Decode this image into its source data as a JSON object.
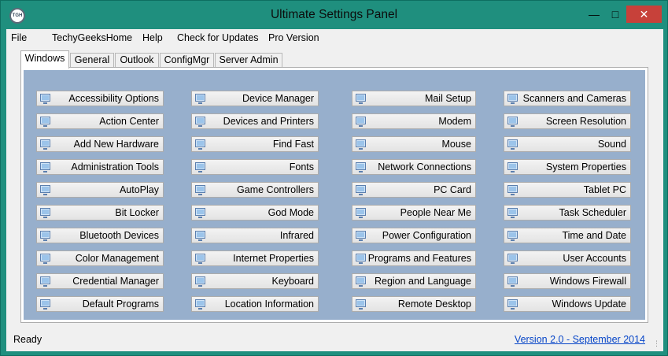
{
  "window": {
    "title": "Ultimate Settings Panel",
    "icon_text": "TGH"
  },
  "menu": [
    {
      "label": "File"
    },
    {
      "label": "TechyGeeksHome"
    },
    {
      "label": "Help"
    },
    {
      "label": "Check for Updates"
    },
    {
      "label": "Pro Version"
    }
  ],
  "tabs": [
    {
      "label": "Windows",
      "active": true
    },
    {
      "label": "General"
    },
    {
      "label": "Outlook"
    },
    {
      "label": "ConfigMgr"
    },
    {
      "label": "Server Admin"
    }
  ],
  "columns": [
    [
      "Accessibility Options",
      "Action Center",
      "Add New Hardware",
      "Administration Tools",
      "AutoPlay",
      "Bit Locker",
      "Bluetooth Devices",
      "Color Management",
      "Credential Manager",
      "Default Programs"
    ],
    [
      "Device Manager",
      "Devices and Printers",
      "Find Fast",
      "Fonts",
      "Game Controllers",
      "God Mode",
      "Infrared",
      "Internet Properties",
      "Keyboard",
      "Location Information"
    ],
    [
      "Mail Setup",
      "Modem",
      "Mouse",
      "Network Connections",
      "PC Card",
      "People Near Me",
      "Power Configuration",
      "Programs and Features",
      "Region and Language",
      "Remote Desktop"
    ],
    [
      "Scanners and Cameras",
      "Screen Resolution",
      "Sound",
      "System Properties",
      "Tablet PC",
      "Task Scheduler",
      "Time and Date",
      "User Accounts",
      "Windows Firewall",
      "Windows Update"
    ]
  ],
  "status": {
    "text": "Ready",
    "version": "Version 2.0 - September 2014"
  },
  "colors": {
    "frame": "#1f8f7e",
    "panel": "#97afcc",
    "close": "#c7413a",
    "link": "#0645c8"
  }
}
